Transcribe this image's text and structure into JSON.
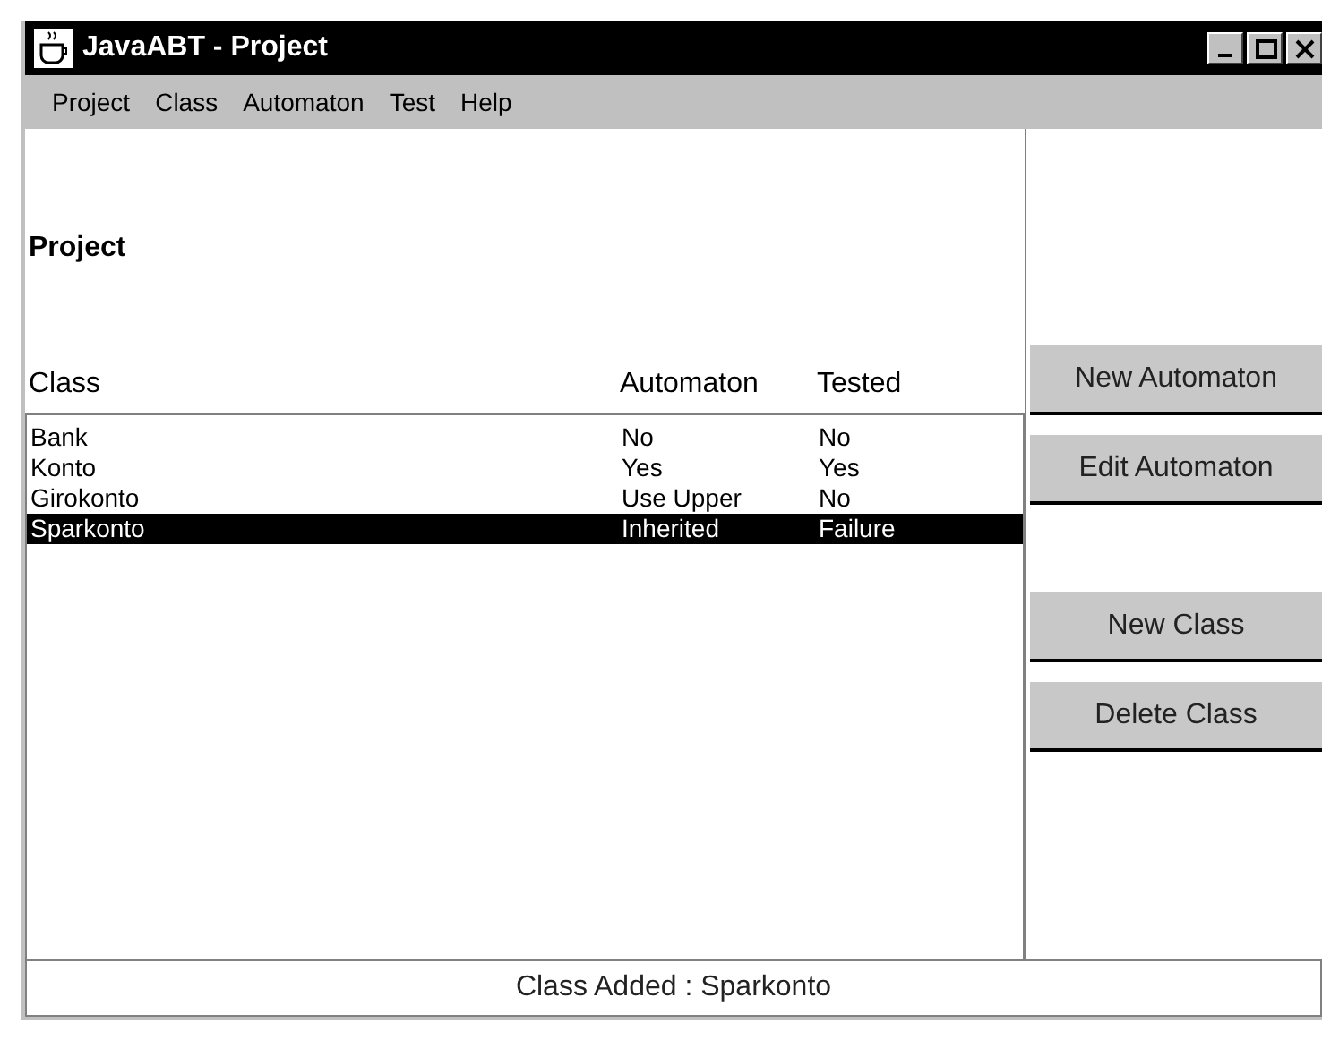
{
  "window": {
    "title": "JavaABT - Project"
  },
  "menu": [
    "Project",
    "Class",
    "Automaton",
    "Test",
    "Help"
  ],
  "heading": "Project",
  "table": {
    "columns": [
      "Class",
      "Automaton",
      "Tested"
    ],
    "rows": [
      {
        "cells": [
          "Bank",
          "No",
          "No"
        ],
        "selected": false
      },
      {
        "cells": [
          "Konto",
          "Yes",
          "Yes"
        ],
        "selected": false
      },
      {
        "cells": [
          "Girokonto",
          "Use Upper",
          "No"
        ],
        "selected": false
      },
      {
        "cells": [
          "Sparkonto",
          "Inherited",
          "Failure"
        ],
        "selected": true
      }
    ]
  },
  "buttons": [
    "New Automaton",
    "Edit Automaton",
    "New Class",
    "Delete Class"
  ],
  "status_bar": "Class Added : Sparkonto"
}
